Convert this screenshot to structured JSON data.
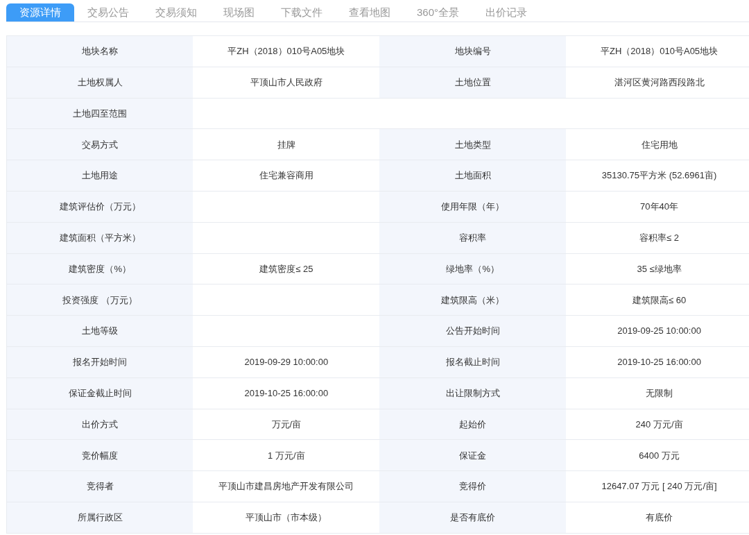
{
  "tabs": [
    {
      "label": "资源详情",
      "selected": true
    },
    {
      "label": "交易公告",
      "selected": false
    },
    {
      "label": "交易须知",
      "selected": false
    },
    {
      "label": "现场图",
      "selected": false
    },
    {
      "label": "下载文件",
      "selected": false
    },
    {
      "label": "查看地图",
      "selected": false
    },
    {
      "label": "360°全景",
      "selected": false
    },
    {
      "label": "出价记录",
      "selected": false
    }
  ],
  "rows": [
    {
      "kind": "pair",
      "cells": [
        {
          "label": "地块名称",
          "value": "平ZH（2018）010号A05地块"
        },
        {
          "label": "地块编号",
          "value": "平ZH（2018）010号A05地块"
        }
      ]
    },
    {
      "kind": "pair",
      "cells": [
        {
          "label": "土地权属人",
          "value": "平顶山市人民政府"
        },
        {
          "label": "土地位置",
          "value": "湛河区黄河路西段路北"
        }
      ]
    },
    {
      "kind": "wide",
      "cells": [
        {
          "label": "土地四至范围"
        }
      ]
    },
    {
      "kind": "pair",
      "cells": [
        {
          "label": "交易方式",
          "value": "挂牌"
        },
        {
          "label": "土地类型",
          "value": "住宅用地"
        }
      ]
    },
    {
      "kind": "pair",
      "cells": [
        {
          "label": "土地用途",
          "value": "住宅兼容商用"
        },
        {
          "label": "土地面积",
          "value": "35130.75平方米 (52.6961亩)"
        }
      ]
    },
    {
      "kind": "pair",
      "cells": [
        {
          "label": "建筑评估价（万元）"
        },
        {
          "label": "使用年限（年）",
          "value": "70年40年"
        }
      ]
    },
    {
      "kind": "pair",
      "cells": [
        {
          "label": "建筑面积（平方米）"
        },
        {
          "label": "容积率",
          "value": "容积率≤ 2"
        }
      ]
    },
    {
      "kind": "pair",
      "cells": [
        {
          "label": "建筑密度（%）",
          "value": "建筑密度≤ 25"
        },
        {
          "label": "绿地率（%）",
          "value": "35 ≤绿地率"
        }
      ]
    },
    {
      "kind": "pair",
      "cells": [
        {
          "label": "投资强度 （万元）"
        },
        {
          "label": "建筑限高（米）",
          "value": "建筑限高≤ 60"
        }
      ]
    },
    {
      "kind": "pair",
      "cells": [
        {
          "label": "土地等级"
        },
        {
          "label": "公告开始时间",
          "value": "2019-09-25 10:00:00"
        }
      ]
    },
    {
      "kind": "pair",
      "cells": [
        {
          "label": "报名开始时间",
          "value": "2019-09-29 10:00:00"
        },
        {
          "label": "报名截止时间",
          "value": "2019-10-25 16:00:00"
        }
      ]
    },
    {
      "kind": "pair",
      "cells": [
        {
          "label": "保证金截止时间",
          "value": "2019-10-25 16:00:00"
        },
        {
          "label": "出让限制方式",
          "value": "无限制"
        }
      ]
    },
    {
      "kind": "pair",
      "cells": [
        {
          "label": "出价方式",
          "value": "万元/亩"
        },
        {
          "label": "起始价",
          "value": "240 万元/亩"
        }
      ]
    },
    {
      "kind": "pair",
      "cells": [
        {
          "label": "竞价幅度",
          "value": "1 万元/亩"
        },
        {
          "label": "保证金",
          "value": "6400 万元"
        }
      ]
    },
    {
      "kind": "pair",
      "cells": [
        {
          "label": "竞得者",
          "value": "平顶山市建昌房地产开发有限公司"
        },
        {
          "label": "竞得价",
          "value": "12647.07 万元 [ 240 万元/亩]"
        }
      ]
    },
    {
      "kind": "pair",
      "cells": [
        {
          "label": "所属行政区",
          "value": "平顶山市（市本级）"
        },
        {
          "label": "是否有底价",
          "value": "有底价"
        }
      ]
    }
  ]
}
